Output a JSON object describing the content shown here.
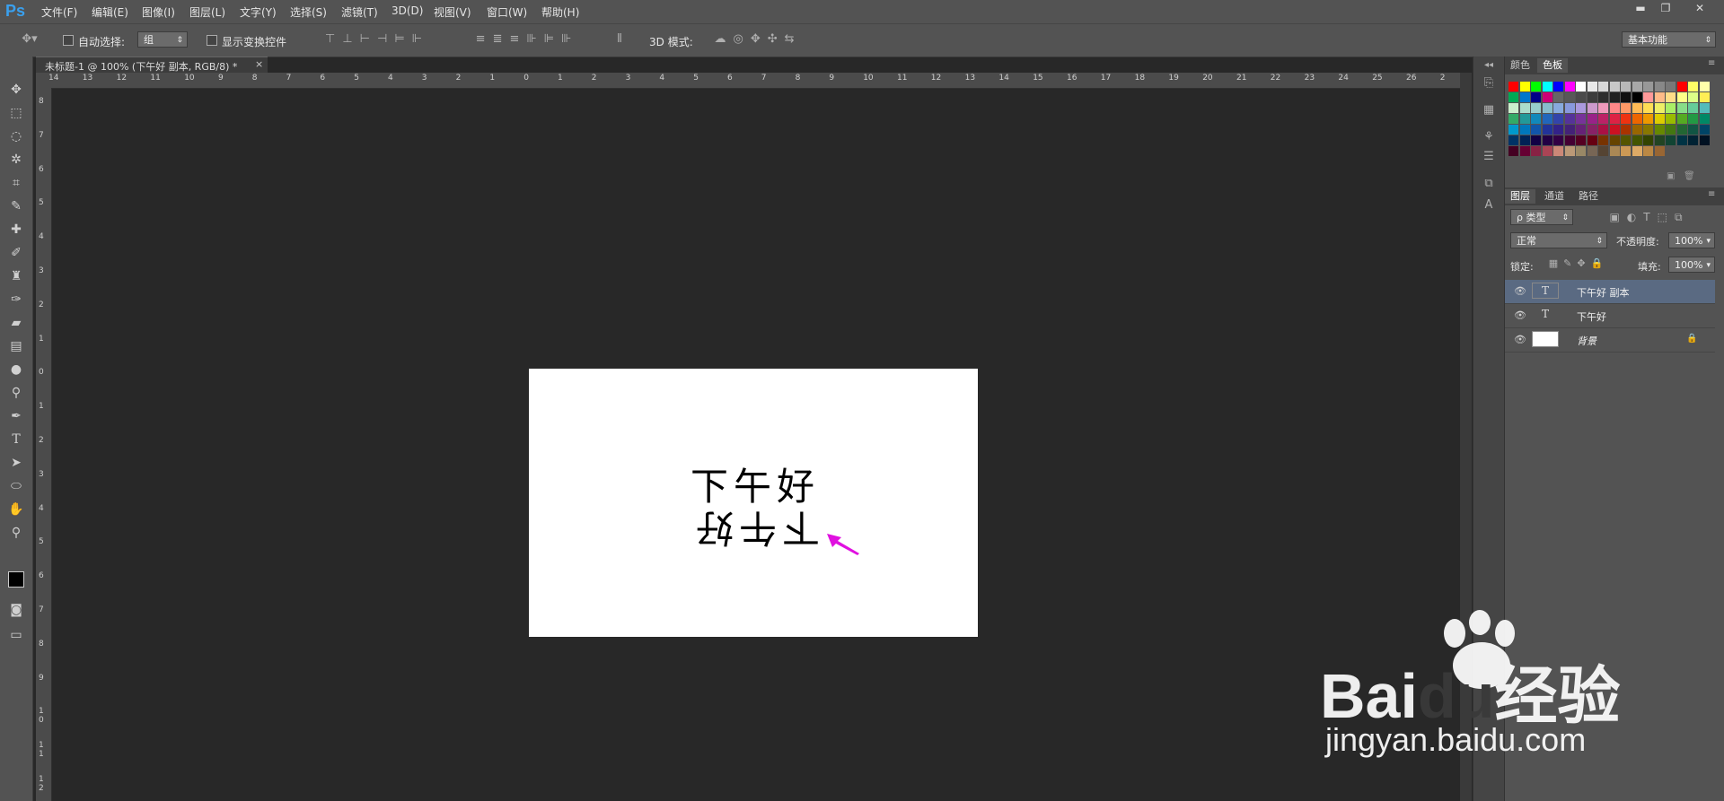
{
  "app": {
    "logo": "Ps"
  },
  "menu": [
    "文件(F)",
    "编辑(E)",
    "图像(I)",
    "图层(L)",
    "文字(Y)",
    "选择(S)",
    "滤镜(T)",
    "3D(D)",
    "视图(V)",
    "窗口(W)",
    "帮助(H)"
  ],
  "window_controls": {
    "minimize": "▬",
    "restore": "❐",
    "close": "✕"
  },
  "options_bar": {
    "auto_select_label": "自动选择:",
    "auto_select_value": "组",
    "show_transform_label": "显示变换控件",
    "mode_3d_label": "3D 模式:",
    "workspace_value": "基本功能"
  },
  "document": {
    "tab_title": "未标题-1 @ 100% (下午好 副本, RGB/8) *",
    "tab_close": "×"
  },
  "ruler_top": [
    "14",
    "13",
    "12",
    "11",
    "10",
    "9",
    "8",
    "7",
    "6",
    "5",
    "4",
    "3",
    "2",
    "1",
    "0",
    "1",
    "2",
    "3",
    "4",
    "5",
    "6",
    "7",
    "8",
    "9",
    "10",
    "11",
    "12",
    "13",
    "14",
    "15",
    "16",
    "17",
    "18",
    "19",
    "20",
    "21",
    "22",
    "23",
    "24",
    "25",
    "26",
    "2"
  ],
  "ruler_left": [
    "8",
    "7",
    "6",
    "5",
    "4",
    "3",
    "2",
    "1",
    "0",
    "1",
    "2",
    "3",
    "4",
    "5",
    "6",
    "7",
    "8",
    "9",
    "1 0",
    "1 1",
    "1 2"
  ],
  "canvas_text": {
    "line1": "下午好",
    "line2": "下午好"
  },
  "color_panel": {
    "tabs": [
      "颜色",
      "色板"
    ],
    "active_tab": "色板"
  },
  "swatch_colors": [
    [
      "#ff0000",
      "#ffff00",
      "#00ff00",
      "#00ffff",
      "#0000ff",
      "#ff00ff",
      "#ffffff",
      "#e8e8e8",
      "#d8d8d8",
      "#c8c8c8",
      "#b8b8b8",
      "#a8a8a8",
      "#989898",
      "#888888",
      "#787878",
      "#ff0000",
      "#ffff66",
      "#ffffaa"
    ],
    [
      "#00aa55",
      "#0077cc",
      "#000088",
      "#cc0077",
      "#666666",
      "#585858",
      "#4a4a4a",
      "#3c3c3c",
      "#2e2e2e",
      "#202020",
      "#101010",
      "#000000",
      "#ff9999",
      "#ffbb88",
      "#ffdd88",
      "#ffff88",
      "#ddff88",
      "#ffee55"
    ],
    [
      "#cceecc",
      "#aaddcc",
      "#99cccc",
      "#88bbcc",
      "#88aadd",
      "#8899dd",
      "#aa99dd",
      "#cc99cc",
      "#ee99bb",
      "#ff8888",
      "#ff9966",
      "#ffbb55",
      "#ffdd55",
      "#eeee66",
      "#aaee66",
      "#88dd88",
      "#66cc99",
      "#55bbbb"
    ],
    [
      "#33aa66",
      "#229999",
      "#1188bb",
      "#2266bb",
      "#3344aa",
      "#553399",
      "#773399",
      "#992288",
      "#bb2266",
      "#dd2244",
      "#ee3311",
      "#ee6600",
      "#ee9900",
      "#ddcc00",
      "#99bb00",
      "#55aa22",
      "#229944",
      "#008866"
    ],
    [
      "#0099cc",
      "#0077bb",
      "#1155aa",
      "#223399",
      "#332288",
      "#442277",
      "#662277",
      "#882266",
      "#aa1144",
      "#cc1122",
      "#aa3300",
      "#996600",
      "#887700",
      "#668800",
      "#447711",
      "#226633",
      "#115544",
      "#004466"
    ],
    [
      "#003366",
      "#002255",
      "#110044",
      "#220044",
      "#330044",
      "#440033",
      "#550022",
      "#660011",
      "#773300",
      "#664400",
      "#555500",
      "#445500",
      "#334400",
      "#224422",
      "#114433",
      "#003344",
      "#002233",
      "#001122"
    ],
    [
      "#440022",
      "#660033",
      "#882244",
      "#aa4455",
      "#cc8877",
      "#bb9977",
      "#998866",
      "#776655",
      "#554433",
      "#aa8855",
      "#cc9955",
      "#ddaa66",
      "#bb8844",
      "#996633"
    ]
  ],
  "layers_panel": {
    "tabs": [
      "图层",
      "通道",
      "路径"
    ],
    "active_tab": "图层",
    "filter_label": "ρ 类型",
    "blend_mode": "正常",
    "opacity_label": "不透明度:",
    "opacity_value": "100%",
    "lock_label": "锁定:",
    "fill_label": "填充:",
    "fill_value": "100%",
    "layers": [
      {
        "name": "下午好 副本",
        "type": "text",
        "selected": true,
        "thumb": "T"
      },
      {
        "name": "下午好",
        "type": "text",
        "selected": false,
        "thumb": "T"
      },
      {
        "name": "背景",
        "type": "background",
        "selected": false,
        "thumb": ""
      }
    ]
  },
  "watermark": {
    "brand_left": "Bai",
    "brand_mid": "du",
    "brand_right": "经验",
    "url": "jingyan.baidu.com"
  },
  "colors": {
    "accent_logo": "#3aa0ee",
    "arrow": "#e010e0",
    "selected_layer": "#5a6a82"
  }
}
